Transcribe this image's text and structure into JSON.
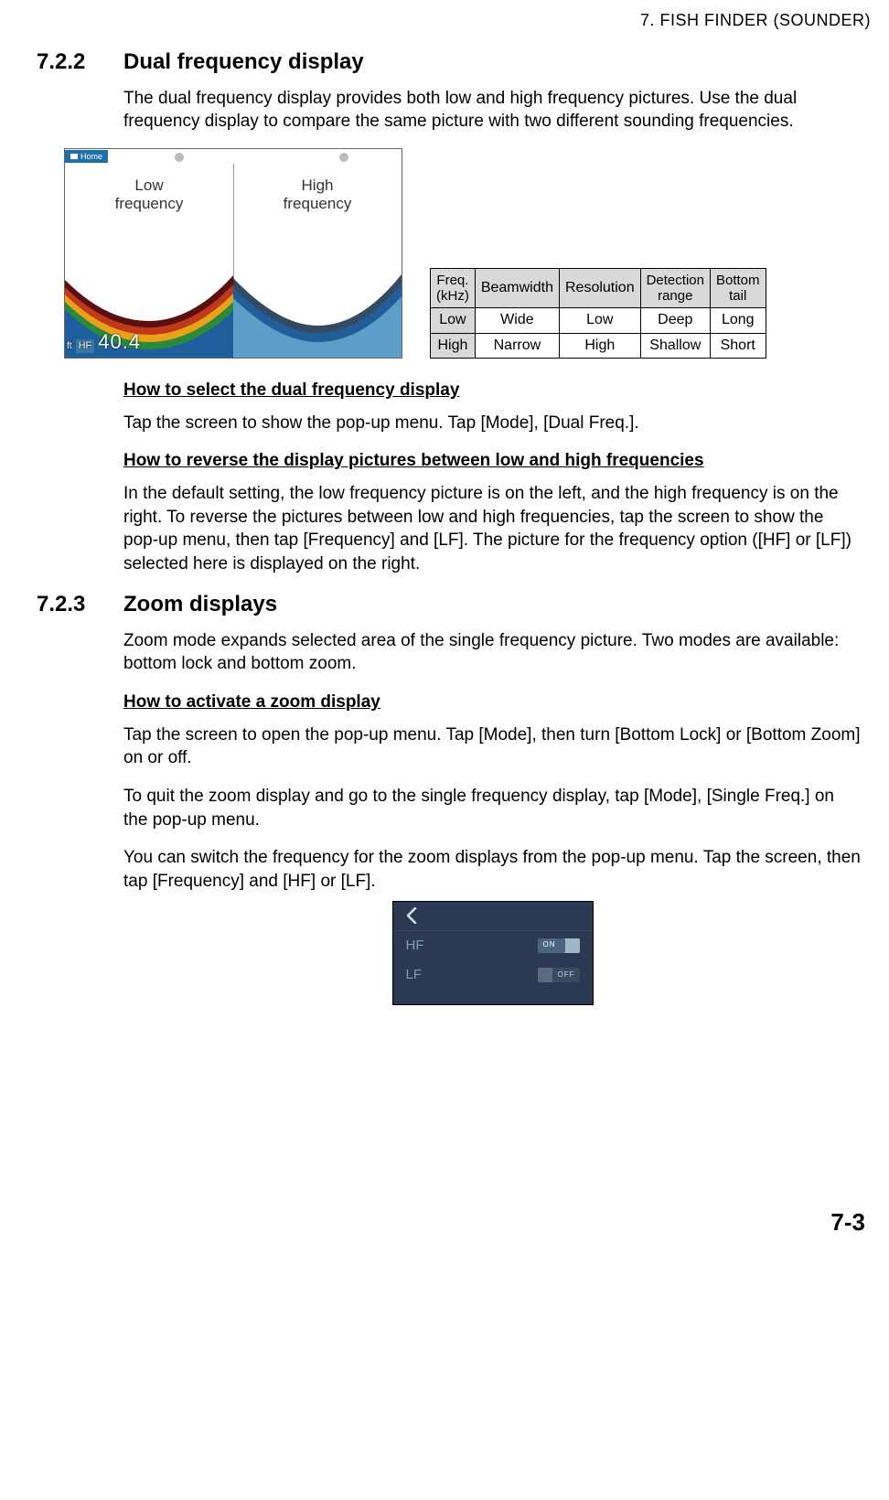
{
  "header": "7.  FISH FINDER (SOUNDER)",
  "sec_722_num": "7.2.2",
  "sec_722_title": "Dual frequency display",
  "sec_722_intro": "The dual frequency display provides both low and high frequency pictures. Use the dual frequency display to compare the same picture with two different sounding frequencies.",
  "fig": {
    "home": "Home",
    "low_l1": "Low",
    "low_l2": "frequency",
    "high_l1": "High",
    "high_l2": "frequency",
    "unit": "ft",
    "hf": "HF",
    "depth": "40.4"
  },
  "table": {
    "h_freq_l1": "Freq.",
    "h_freq_l2": "(kHz)",
    "h_beam": "Beamwidth",
    "h_res": "Resolution",
    "h_det_l1": "Detection",
    "h_det_l2": "range",
    "h_bt_l1": "Bottom",
    "h_bt_l2": "tail",
    "r1": {
      "f": "Low",
      "b": "Wide",
      "r": "Low",
      "d": "Deep",
      "t": "Long"
    },
    "r2": {
      "f": "High",
      "b": "Narrow",
      "r": "High",
      "d": "Shallow",
      "t": "Short"
    }
  },
  "sub1_title": "How to select the dual frequency display",
  "sub1_p1": "Tap the screen to show the pop-up menu. Tap [Mode], [Dual Freq.].",
  "sub2_title": "How to reverse the display pictures between low and high frequencies",
  "sub2_p1": "In the default setting, the low frequency picture is on the left, and the high frequency is on the right. To reverse the pictures between low and high frequencies, tap the screen to show the pop-up menu, then tap [Frequency] and [LF]. The picture for the frequency option ([HF] or [LF]) selected here is displayed on the right.",
  "sec_723_num": "7.2.3",
  "sec_723_title": "Zoom displays",
  "sec_723_intro": "Zoom mode expands selected area of the single frequency picture. Two modes are available: bottom lock and bottom zoom.",
  "sub3_title": "How to activate a zoom display",
  "sub3_p1": "Tap the screen to open the pop-up menu. Tap [Mode], then turn [Bottom Lock] or [Bottom Zoom] on or off.",
  "sub3_p2": "To quit the zoom display and go to the single frequency display, tap [Mode], [Single Freq.] on the pop-up menu.",
  "sub3_p3": "You can switch the frequency for the zoom displays from the pop-up menu. Tap the screen, then tap [Frequency] and [HF] or [LF].",
  "popup": {
    "hf": "HF",
    "lf": "LF",
    "on": "ON",
    "off": "OFF"
  },
  "pagenum": "7-3"
}
